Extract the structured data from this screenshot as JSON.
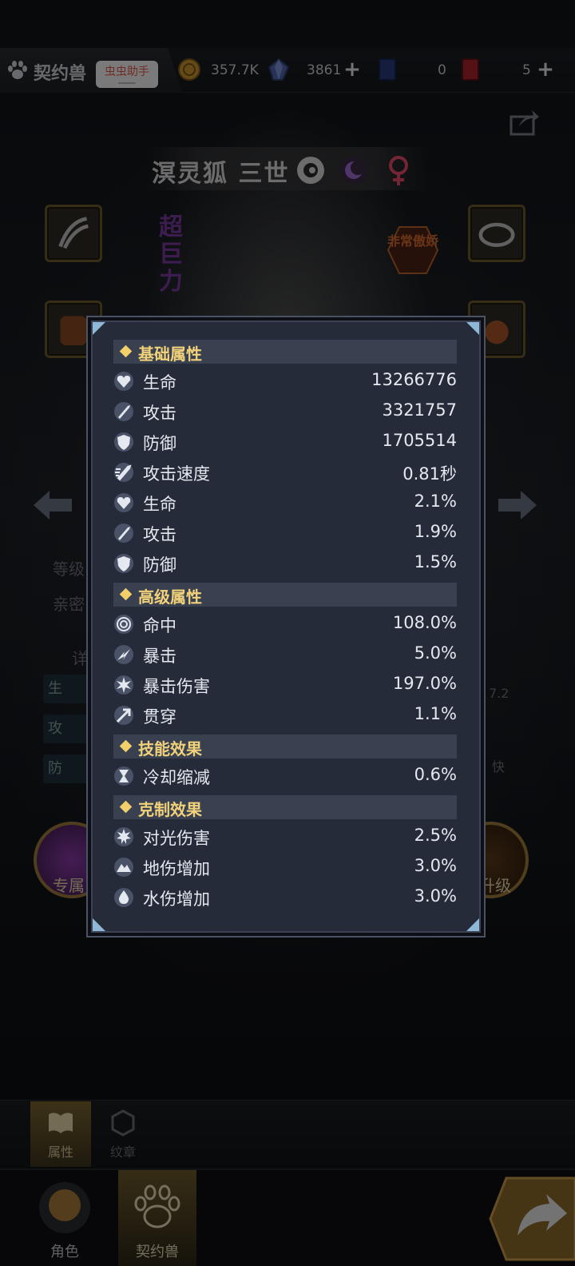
{
  "topbar": {
    "title": "契约兽",
    "helper_badge": "虫虫助手",
    "gold": "357.7K",
    "crystal": "3861",
    "ticket_blue": "0",
    "ticket_red": "5"
  },
  "creature": {
    "name": "溟灵狐 三世",
    "vertical_label": "超巨力",
    "trait": "非常傲娇"
  },
  "background": {
    "level_label": "等级",
    "intimacy_label": "亲密",
    "detail_label": "详",
    "chip_hp": "生",
    "chip_atk": "攻",
    "chip_def": "防",
    "right_value": "7.2",
    "right_speed": "快",
    "exclusive_label": "专属",
    "upgrade_label": "升级"
  },
  "stats_panel": {
    "sections": [
      {
        "title": "基础属性",
        "rows": [
          {
            "icon": "heart-icon",
            "label": "生命",
            "value": "13266776"
          },
          {
            "icon": "sword-icon",
            "label": "攻击",
            "value": "3321757"
          },
          {
            "icon": "shield-icon",
            "label": "防御",
            "value": "1705514"
          },
          {
            "icon": "speed-icon",
            "label": "攻击速度",
            "value": "0.81秒"
          },
          {
            "icon": "heart-icon",
            "label": "生命",
            "value": "2.1%"
          },
          {
            "icon": "sword-icon",
            "label": "攻击",
            "value": "1.9%"
          },
          {
            "icon": "shield-icon",
            "label": "防御",
            "value": "1.5%"
          }
        ]
      },
      {
        "title": "高级属性",
        "rows": [
          {
            "icon": "target-icon",
            "label": "命中",
            "value": "108.0%"
          },
          {
            "icon": "crit-icon",
            "label": "暴击",
            "value": "5.0%"
          },
          {
            "icon": "burst-icon",
            "label": "暴击伤害",
            "value": "197.0%"
          },
          {
            "icon": "pierce-icon",
            "label": "贯穿",
            "value": "1.1%"
          }
        ]
      },
      {
        "title": "技能效果",
        "rows": [
          {
            "icon": "hourglass-icon",
            "label": "冷却缩减",
            "value": "0.6%"
          }
        ]
      },
      {
        "title": "克制效果",
        "rows": [
          {
            "icon": "light-icon",
            "label": "对光伤害",
            "value": "2.5%"
          },
          {
            "icon": "earth-icon",
            "label": "地伤增加",
            "value": "3.0%"
          },
          {
            "icon": "water-icon",
            "label": "水伤增加",
            "value": "3.0%"
          }
        ]
      }
    ]
  },
  "subtabs": {
    "attributes": "属性",
    "emblem": "纹章"
  },
  "bottom_nav": {
    "character": "角色",
    "contract_beast": "契约兽"
  },
  "colors": {
    "panel_bg": "#262b3a",
    "section_header_bg": "#39404f",
    "section_title": "#f1d27a",
    "gold_accent": "#6d5b2a"
  }
}
